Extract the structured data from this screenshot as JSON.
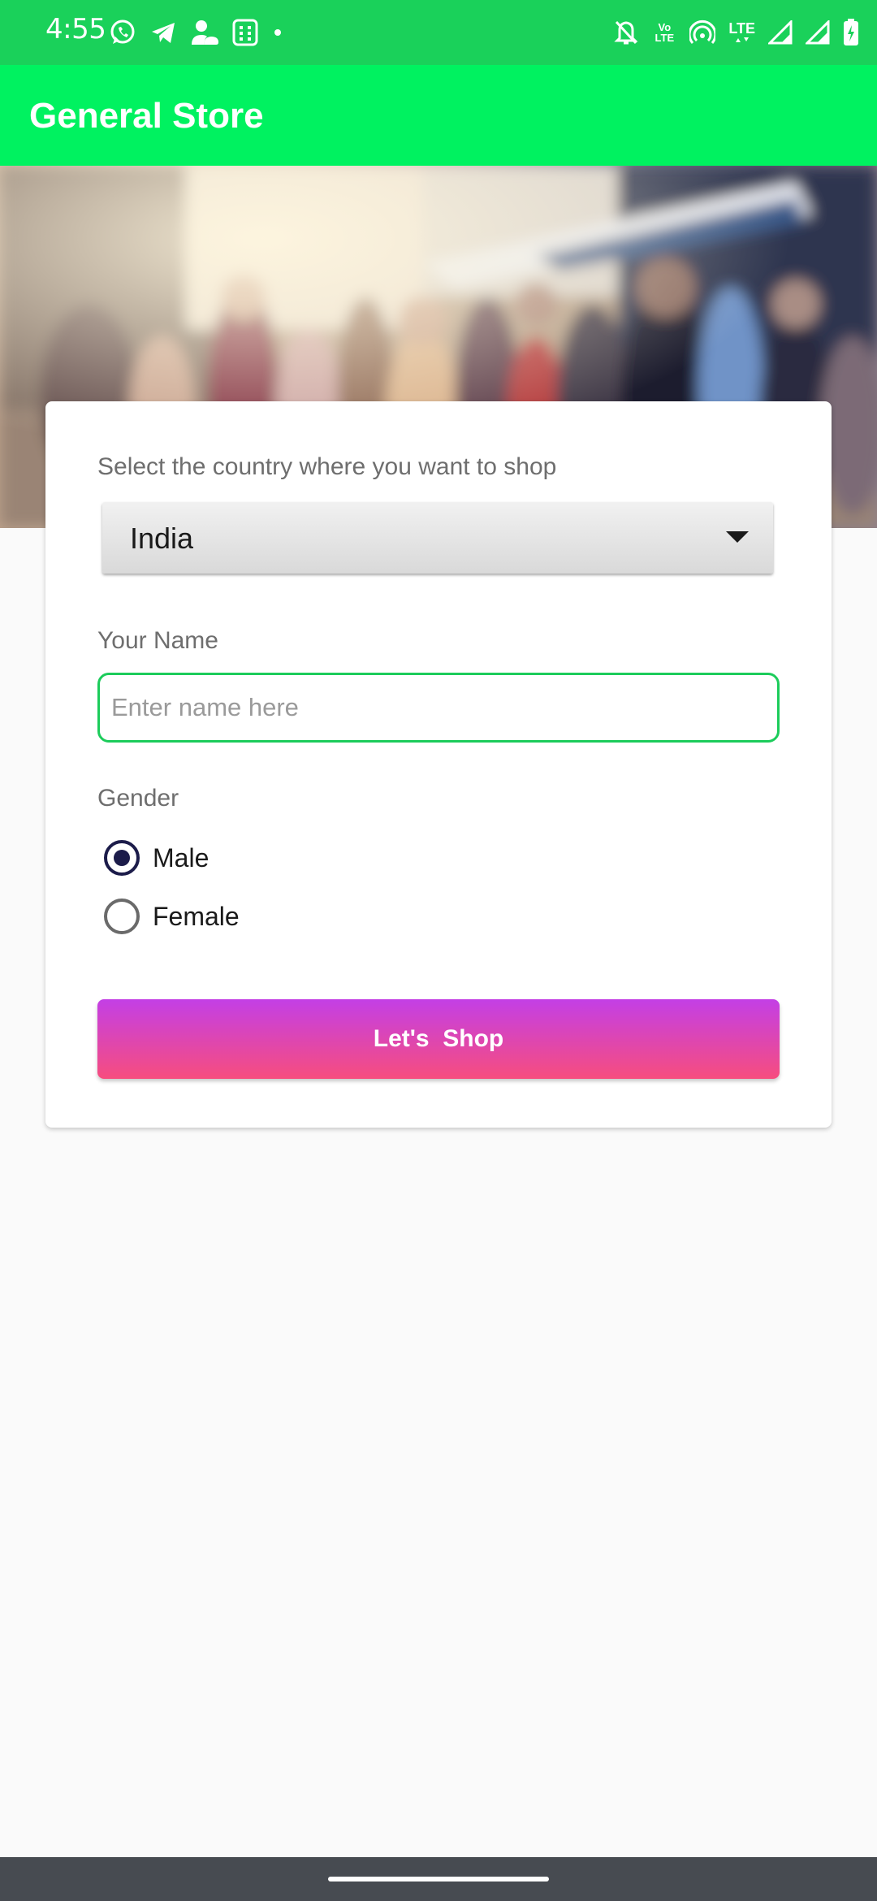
{
  "status_bar": {
    "time": "4:55",
    "left_icons": [
      "whatsapp-icon",
      "telegram-icon",
      "cloud-person-icon",
      "calculator-icon",
      "dot-icon"
    ],
    "right_icons": [
      "bell-off-icon",
      "volte-icon",
      "hotspot-icon",
      "lte-icon",
      "signal-icon",
      "signal-icon",
      "battery-charging-icon"
    ],
    "volte_label": "Vo LTE",
    "lte_label": "LTE",
    "background": "#1ad15a"
  },
  "app_bar": {
    "title": "General Store",
    "background": "#00f260"
  },
  "form": {
    "country_label": "Select the country where you want to shop",
    "country_selected": "India",
    "name_label": "Your Name",
    "name_placeholder": "Enter name here",
    "name_value": "",
    "gender_label": "Gender",
    "gender_options": [
      {
        "label": "Male",
        "checked": true
      },
      {
        "label": "Female",
        "checked": false
      }
    ],
    "submit_label": "Let's  Shop",
    "submit_gradient": [
      "#c33fe6",
      "#f74d7e"
    ]
  }
}
